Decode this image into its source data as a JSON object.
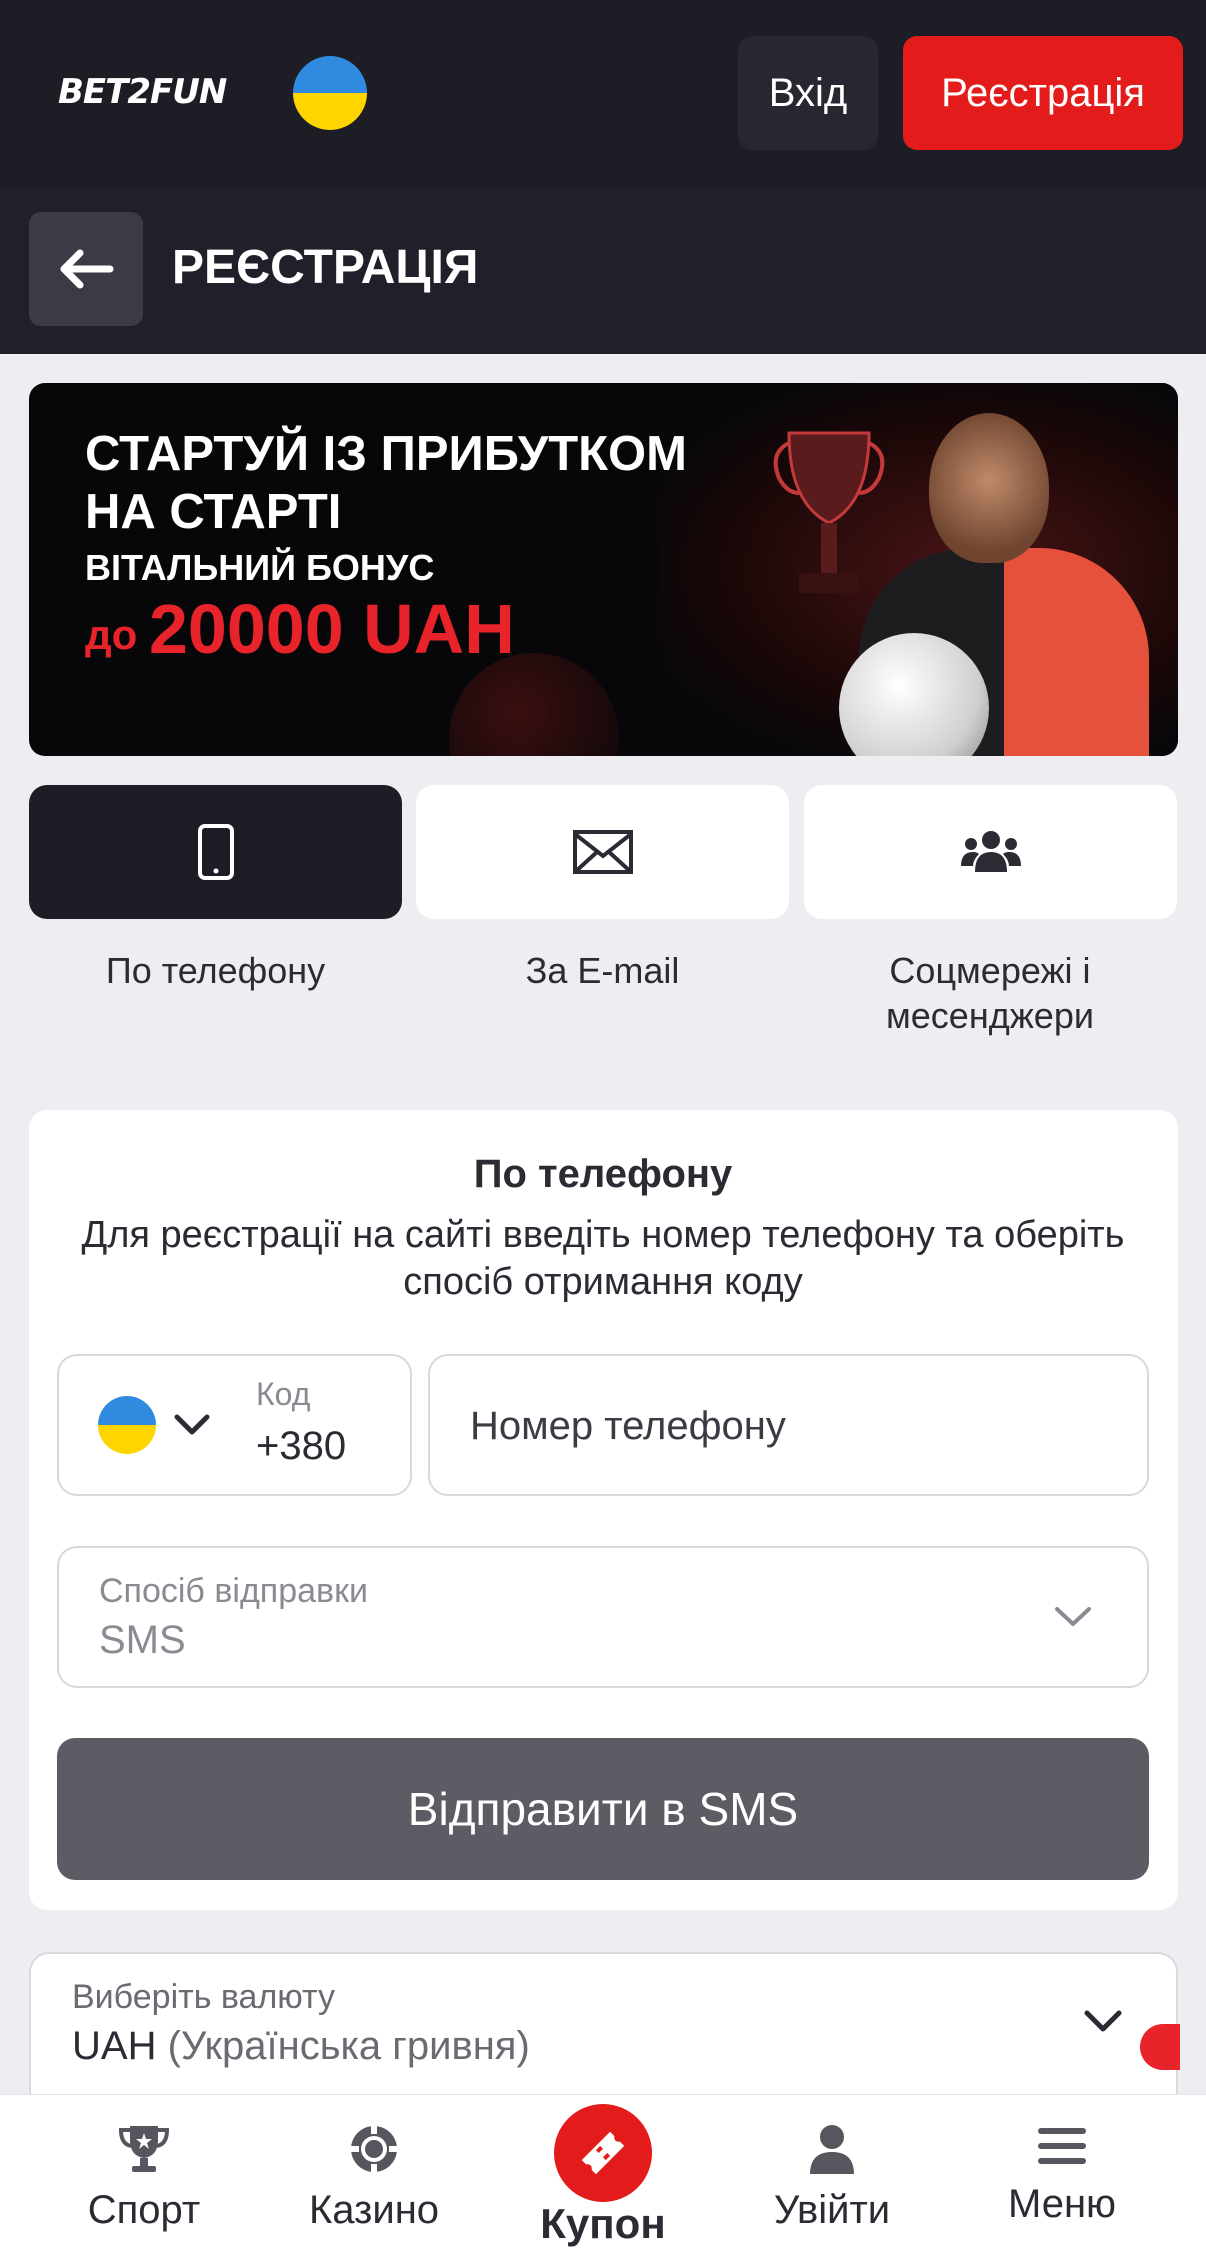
{
  "header": {
    "logo": "BET2FUN",
    "login_label": "Вхід",
    "register_label": "Реєстрація"
  },
  "subheader": {
    "title": "РЕЄСТРАЦІЯ"
  },
  "banner": {
    "line1": "СТАРТУЙ ІЗ ПРИБУТКОМ",
    "line2": "НА СТАРТІ",
    "bonus_label": "ВІТАЛЬНИЙ БОНУС",
    "amount_prefix": "до",
    "amount": "20000 UAH"
  },
  "methods": [
    {
      "label": "По телефону",
      "icon": "phone-icon",
      "active": true
    },
    {
      "label": "За E-mail",
      "icon": "envelope-icon",
      "active": false
    },
    {
      "label": "Соцмережі і месенджери",
      "icon": "users-icon",
      "active": false
    }
  ],
  "form": {
    "title": "По телефону",
    "description": "Для реєстрації на сайті введіть номер телефону та оберіть спосіб отримання коду",
    "code_label": "Код",
    "code_value": "+380",
    "phone_placeholder": "Номер телефону",
    "send_method_label": "Спосіб відправки",
    "send_method_value": "SMS",
    "submit_label": "Відправити в SMS"
  },
  "currency": {
    "label": "Виберіть валюту",
    "code": "UAH",
    "name": "(Українська гривня)"
  },
  "bottom_nav": [
    {
      "label": "Спорт",
      "icon": "trophy-icon"
    },
    {
      "label": "Казино",
      "icon": "casino-chip-icon"
    },
    {
      "label": "Купон",
      "icon": "ticket-icon"
    },
    {
      "label": "Увійти",
      "icon": "user-icon"
    },
    {
      "label": "Меню",
      "icon": "hamburger-menu-icon"
    }
  ],
  "colors": {
    "header_bg": "#1c1d25",
    "accent_red": "#e41b1b",
    "page_bg": "#eeeef2",
    "submit_disabled": "#5c5d64"
  }
}
